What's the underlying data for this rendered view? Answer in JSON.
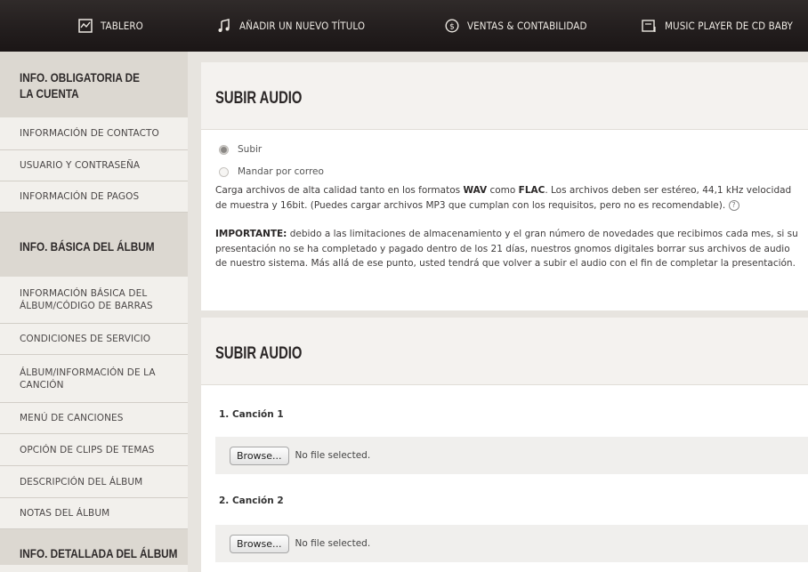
{
  "nav": {
    "items": [
      {
        "label": "TABLERO",
        "icon": "dashboard-icon"
      },
      {
        "label": "AÑADIR UN NUEVO TÍTULO",
        "icon": "music-note-icon"
      },
      {
        "label": "VENTAS & CONTABILIDAD",
        "icon": "dollar-circle-icon"
      },
      {
        "label": "MUSIC PLAYER DE CD BABY",
        "icon": "player-icon"
      }
    ]
  },
  "sidebar": {
    "heading1": "INFO. OBLIGATORIA DE LA CUENTA",
    "group1": [
      "INFORMACIÓN DE CONTACTO",
      "USUARIO Y CONTRASEÑA",
      "INFORMACIÓN DE PAGOS"
    ],
    "heading2": "INFO. BÁSICA DEL ÁLBUM",
    "group2": [
      "INFORMACIÓN BÁSICA DEL ÁLBUM/CÓDIGO DE BARRAS",
      "CONDICIONES DE SERVICIO",
      "ÁLBUM/INFORMACIÓN DE LA CANCIÓN",
      "MENÚ DE CANCIONES",
      "OPCIÓN DE CLIPS DE TEMAS",
      "DESCRIPCIÓN DEL ÁLBUM",
      "NOTAS DEL ÁLBUM"
    ],
    "heading3": "INFO. DETALLADA DEL ÁLBUM"
  },
  "panel1": {
    "title": "SUBIR AUDIO",
    "option_upload": "Subir",
    "option_mail": "Mandar por correo",
    "para1_a": "Carga archivos de alta calidad tanto en los formatos ",
    "para1_wav": "WAV",
    "para1_b": " como ",
    "para1_flac": "FLAC",
    "para1_c": ". Los archivos deben ser estéreo, 44,1 kHz velocidad de muestra y 16bit. (Puedes cargar archivos MP3 que cumplan con los requisitos, pero no es recomendable).",
    "para2_bold": "IMPORTANTE:",
    "para2": " debido a las limitaciones de almacenamiento y el gran número de novedades que recibimos cada mes, si su presentación no se ha completado y pagado dentro de los 21 días, nuestros gnomos digitales borrar sus archivos de audio de nuestro sistema. Más allá de ese punto, usted tendrá que volver a subir el audio con el fin de completar la presentación."
  },
  "panel2": {
    "title": "SUBIR AUDIO",
    "songs": [
      {
        "label": "1. Canción 1",
        "button": "Browse...",
        "status": "No file selected."
      },
      {
        "label": "2. Canción 2",
        "button": "Browse...",
        "status": "No file selected."
      }
    ]
  },
  "colors": {
    "nav_bg": "#231e1e",
    "sidebar_heading_bg": "#dcd8d1",
    "page_bg": "#e7e4df"
  }
}
